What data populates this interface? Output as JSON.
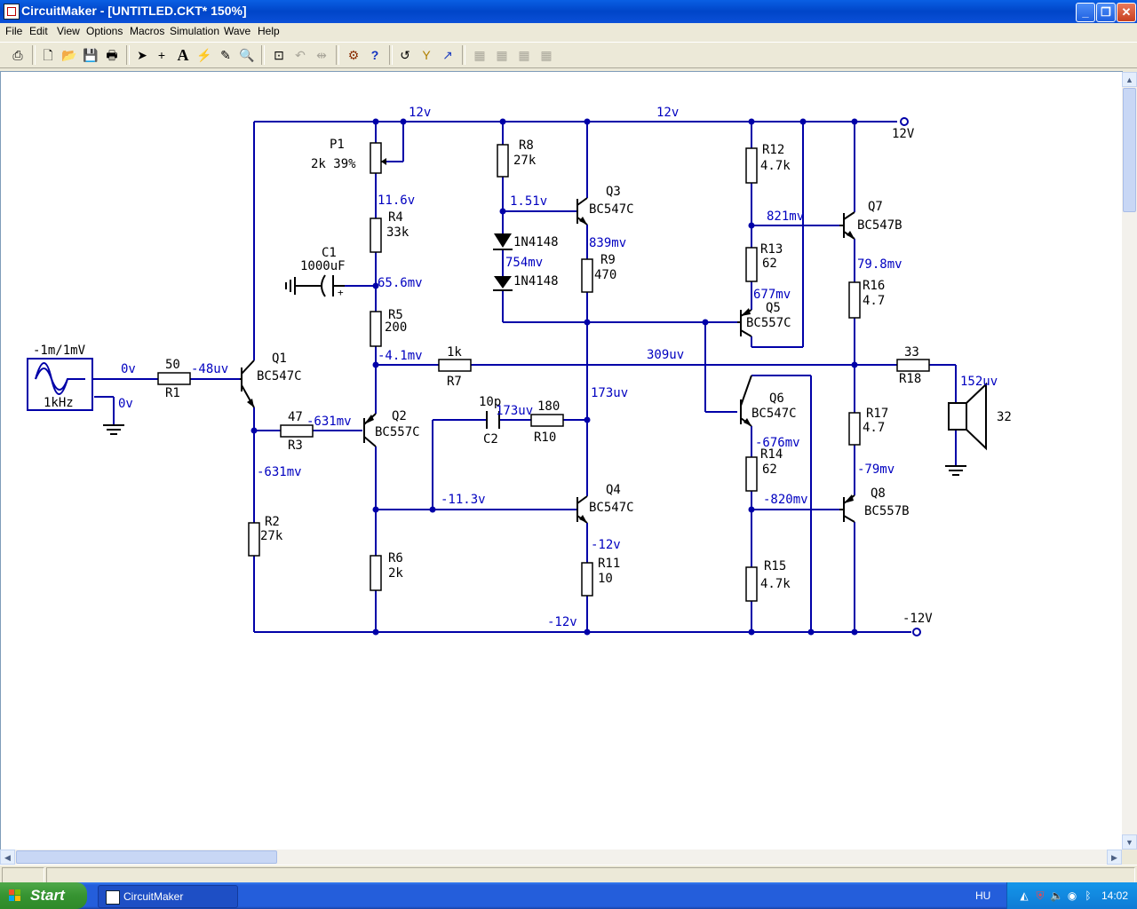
{
  "window": {
    "title": "CircuitMaker - [UNTITLED.CKT* 150%]"
  },
  "menu": [
    "File",
    "Edit",
    "View",
    "Options",
    "Macros",
    "Simulation",
    "Wave",
    "Help"
  ],
  "toolbar_icons": [
    "print-setup-icon",
    "new-file-icon",
    "open-file-icon",
    "save-icon",
    "print-icon",
    "arrow-tool-icon",
    "wire-tool-icon",
    "text-tool-icon",
    "probe-tool-icon",
    "delete-tool-icon",
    "zoom-tool-icon",
    "zoom-fit-icon",
    "rotate-icon",
    "mirror-icon",
    "digital-logic-icon",
    "help-icon",
    "reset-icon",
    "step-icon",
    "run-icon",
    "align-icon",
    "align2-icon",
    "align3-icon",
    "align4-icon"
  ],
  "schematic": {
    "generator": {
      "amplitude": "-1m/1mV",
      "frequency": "1kHz"
    },
    "components": {
      "P1": {
        "ref": "P1",
        "value": "2k 39%"
      },
      "R1": {
        "ref": "R1",
        "value": "50"
      },
      "R2": {
        "ref": "R2",
        "value": "27k"
      },
      "R3": {
        "ref": "R3",
        "value": "47"
      },
      "R4": {
        "ref": "R4",
        "value": "33k"
      },
      "R5": {
        "ref": "R5",
        "value": "200"
      },
      "R6": {
        "ref": "R6",
        "value": "2k"
      },
      "R7": {
        "ref": "R7",
        "value": "1k"
      },
      "R8": {
        "ref": "R8",
        "value": "27k"
      },
      "R9": {
        "ref": "R9",
        "value": "470"
      },
      "R10": {
        "ref": "R10",
        "value": "180"
      },
      "R11": {
        "ref": "R11",
        "value": "10"
      },
      "R12": {
        "ref": "R12",
        "value": "4.7k"
      },
      "R13": {
        "ref": "R13",
        "value": "62"
      },
      "R14": {
        "ref": "R14",
        "value": "62"
      },
      "R15": {
        "ref": "R15",
        "value": "4.7k"
      },
      "R16": {
        "ref": "R16",
        "value": "4.7"
      },
      "R17": {
        "ref": "R17",
        "value": "4.7"
      },
      "R18": {
        "ref": "R18",
        "value": "33"
      },
      "C1": {
        "ref": "C1",
        "value": "1000uF"
      },
      "C2": {
        "ref": "C2",
        "value": "10p"
      },
      "D1": {
        "value": "1N4148"
      },
      "D2": {
        "value": "1N4148"
      },
      "Q1": {
        "ref": "Q1",
        "value": "BC547C"
      },
      "Q2": {
        "ref": "Q2",
        "value": "BC557C"
      },
      "Q3": {
        "ref": "Q3",
        "value": "BC547C"
      },
      "Q4": {
        "ref": "Q4",
        "value": "BC547C"
      },
      "Q5": {
        "ref": "Q5",
        "value": "BC557C"
      },
      "Q6": {
        "ref": "Q6",
        "value": "BC547C"
      },
      "Q7": {
        "ref": "Q7",
        "value": "BC547B"
      },
      "Q8": {
        "ref": "Q8",
        "value": "BC557B"
      },
      "SPK": {
        "value": "32"
      }
    },
    "supplies": {
      "pos": "12V",
      "neg": "-12V"
    },
    "voltages": {
      "v_top1": "12v",
      "v_top2": "12v",
      "v_gen_out": "0v",
      "v_gen_gnd": "0v",
      "v_q1_base": "-48uv",
      "v_r4_top": "11.6v",
      "v_c1": "65.6mv",
      "v_r5_bot": "-4.1mv",
      "v_r3_left": "-631mv",
      "v_r3_right": "-631mv",
      "v_r8_bot": "1.51v",
      "v_d_mid": "754mv",
      "v_q3_e": "839mv",
      "v_c2_node": "173uv",
      "v_q4_c": "173uv",
      "v_q4_b": "-11.3v",
      "v_q4_e": "-12v",
      "v_bot_rail": "-12v",
      "v_r13_top": "821mv",
      "v_r13_bot": "677mv",
      "v_out": "309uv",
      "v_r16_top": "79.8mv",
      "v_spk": "152uv",
      "v_r14_top": "-676mv",
      "v_r14_bot": "-820mv",
      "v_r17_bot": "-79mv"
    }
  },
  "taskbar": {
    "start": "Start",
    "task": "CircuitMaker",
    "lang": "HU",
    "clock": "14:02"
  }
}
